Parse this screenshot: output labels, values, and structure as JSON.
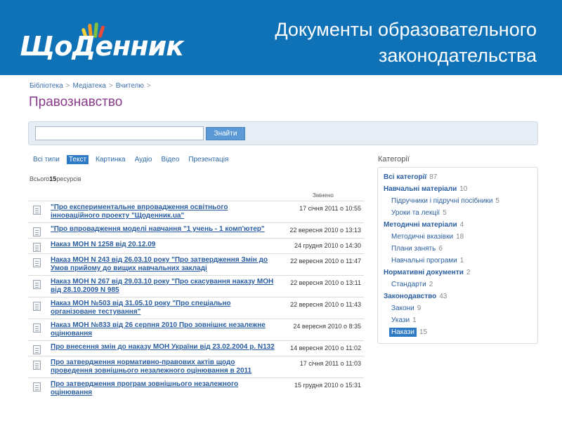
{
  "header": {
    "logo": "ЩоДенник",
    "title_line1": "Документы образовательного",
    "title_line2": "законодательства"
  },
  "breadcrumb": [
    "Бібліотека",
    "Медіатека",
    "Вчителю"
  ],
  "page_title": "Правознавство",
  "search": {
    "value": "",
    "placeholder": "",
    "button": "Знайти"
  },
  "filters": [
    {
      "label": "Всі типи",
      "active": false
    },
    {
      "label": "Текст",
      "active": true
    },
    {
      "label": "Картинка",
      "active": false
    },
    {
      "label": "Аудіо",
      "active": false
    },
    {
      "label": "Відео",
      "active": false
    },
    {
      "label": "Презентація",
      "active": false
    }
  ],
  "total": {
    "prefix": "Всього",
    "count": "15",
    "suffix": "ресурсів"
  },
  "column_header": "Змінено",
  "documents": [
    {
      "title": "\"Про експериментальне впровадження освітнього інноваційного проекту \"Щоденник.ua\"",
      "date": "17 січня 2011 о 10:55"
    },
    {
      "title": "\"Про впровадження моделі навчання \"1 учень - 1 комп'ютер\"",
      "date": "22 вересня 2010 о 13:13"
    },
    {
      "title": "Наказ МОН N 1258 від 20.12.09",
      "date": "24 грудня 2010 о 14:30"
    },
    {
      "title": "Наказ МОН N 243 від 26.03.10 року \"Про затвердження Змін до Умов прийому до вищих навчальних закладі",
      "date": "22 вересня 2010 о 11:47"
    },
    {
      "title": "Наказ МОН N 267 від 29.03.10 року \"Про скасування наказу МОН від 28.10.2009 N 985",
      "date": "22 вересня 2010 о 13:11"
    },
    {
      "title": "Наказ МОН №503 від 31.05.10 року \"Про спеціально організоване тестування\"",
      "date": "22 вересня 2010 о 11:43"
    },
    {
      "title": "Наказ МОН №833 від 26 серпня 2010 Про зовнішнє незалежне оцінювання",
      "date": "24 вересня 2010 о 8:35"
    },
    {
      "title": "Про внесення змін до наказу МОН України від 23.02.2004 р. N132",
      "date": "14 вересня 2010 о 11:02"
    },
    {
      "title": "Про затвердження нормативно-правових актів щодо проведення зовнішнього незалежного оцінювання в 2011",
      "date": "17 січня 2011 о 11:03"
    },
    {
      "title": "Про затвердження програм зовнішнього незалежного оцінювання",
      "date": "15 грудня 2010 о 15:31"
    }
  ],
  "categories": {
    "title": "Категорії",
    "items": [
      {
        "label": "Всі категорії",
        "count": "87",
        "level": 0,
        "active": false
      },
      {
        "label": "Навчальні матеріали",
        "count": "10",
        "level": 0,
        "active": false
      },
      {
        "label": "Підручники і підручні посібники",
        "count": "5",
        "level": 1,
        "active": false
      },
      {
        "label": "Уроки та лекції",
        "count": "5",
        "level": 1,
        "active": false
      },
      {
        "label": "Методичні матеріали",
        "count": "4",
        "level": 0,
        "active": false
      },
      {
        "label": "Методичні вказівки",
        "count": "18",
        "level": 1,
        "active": false
      },
      {
        "label": "Плани занять",
        "count": "6",
        "level": 1,
        "active": false
      },
      {
        "label": "Навчальні програми",
        "count": "1",
        "level": 1,
        "active": false
      },
      {
        "label": "Нормативні документи",
        "count": "2",
        "level": 0,
        "active": false
      },
      {
        "label": "Стандарти",
        "count": "2",
        "level": 1,
        "active": false
      },
      {
        "label": "Законодавство",
        "count": "43",
        "level": 0,
        "active": false
      },
      {
        "label": "Закони",
        "count": "9",
        "level": 1,
        "active": false
      },
      {
        "label": "Укази",
        "count": "1",
        "level": 1,
        "active": false
      },
      {
        "label": "Накази",
        "count": "15",
        "level": 1,
        "active": true
      }
    ]
  },
  "colors": {
    "header_bg": "#0f72b7",
    "title_purple": "#8a3a8a",
    "link_blue": "#2a5ea0",
    "active_blue": "#2f7ac4"
  }
}
